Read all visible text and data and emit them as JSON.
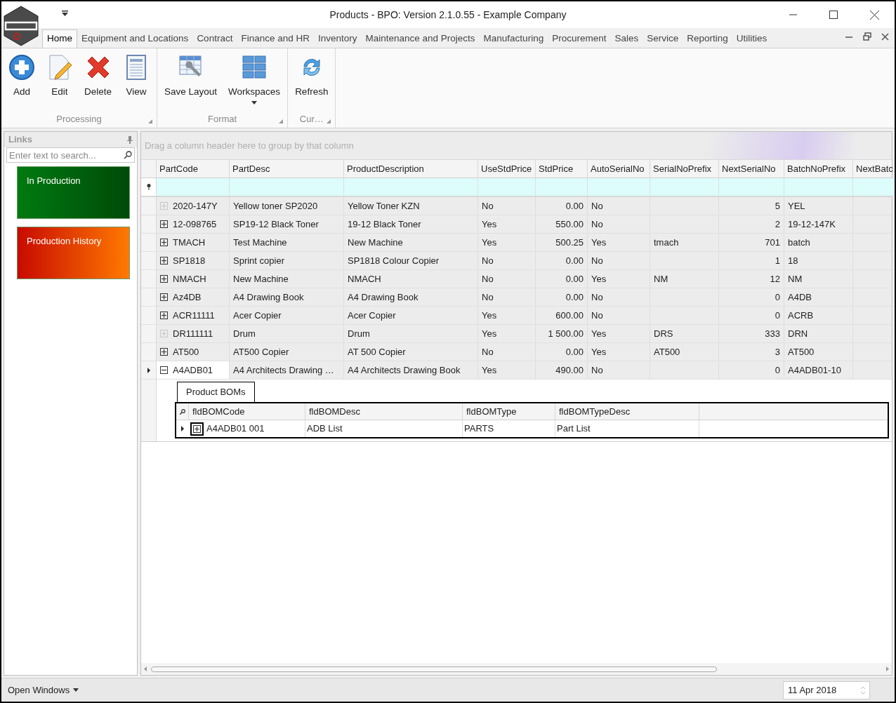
{
  "window": {
    "title": "Products - BPO: Version 2.1.0.55 - Example Company"
  },
  "tabs": [
    {
      "label": "Home",
      "selected": true
    },
    {
      "label": "Equipment and Locations",
      "selected": false
    },
    {
      "label": "Contract",
      "selected": false
    },
    {
      "label": "Finance and HR",
      "selected": false
    },
    {
      "label": "Inventory",
      "selected": false
    },
    {
      "label": "Maintenance and Projects",
      "selected": false
    },
    {
      "label": "Manufacturing",
      "selected": false
    },
    {
      "label": "Procurement",
      "selected": false
    },
    {
      "label": "Sales",
      "selected": false
    },
    {
      "label": "Service",
      "selected": false
    },
    {
      "label": "Reporting",
      "selected": false
    },
    {
      "label": "Utilities",
      "selected": false
    }
  ],
  "ribbon_groups": [
    {
      "label": "Processing",
      "buttons": [
        {
          "label": "Add",
          "kind": "add",
          "dropdown": false
        },
        {
          "label": "Edit",
          "kind": "edit",
          "dropdown": false
        },
        {
          "label": "Delete",
          "kind": "delete",
          "dropdown": false
        },
        {
          "label": "View",
          "kind": "view",
          "dropdown": false
        }
      ]
    },
    {
      "label": "Format",
      "buttons": [
        {
          "label": "Save Layout",
          "kind": "layout",
          "dropdown": false
        },
        {
          "label": "Workspaces",
          "kind": "workspaces",
          "dropdown": true
        }
      ]
    },
    {
      "label": "Cur…",
      "buttons": [
        {
          "label": "Refresh",
          "kind": "refresh",
          "dropdown": false
        }
      ]
    }
  ],
  "links_panel": {
    "title": "Links",
    "search": {
      "placeholder": "Enter text to search..."
    },
    "tiles": [
      {
        "label": "In Production",
        "color": "#007a10"
      },
      {
        "label": "Production History",
        "color": "#c80a00"
      }
    ]
  },
  "grid": {
    "group_hint": "Drag a column header here to group by that column",
    "columns": [
      "PartCode",
      "PartDesc",
      "ProductDescription",
      "UseStdPrice",
      "StdPrice",
      "AutoSerialNo",
      "SerialNoPrefix",
      "NextSerialNo",
      "BatchNoPrefix",
      "NextBatc"
    ],
    "rows": [
      {
        "cells": [
          "2020-147Y",
          "Yellow toner SP2020",
          "Yellow Toner KZN",
          "No",
          "0.00",
          "No",
          "",
          "5",
          "YEL",
          ""
        ],
        "has_children": false,
        "expanded": false,
        "selected": false
      },
      {
        "cells": [
          "12-098765",
          "SP19-12 Black Toner",
          "19-12 Black Toner",
          "Yes",
          "550.00",
          "No",
          "",
          "2",
          "19-12-147K",
          ""
        ],
        "has_children": true,
        "expanded": false,
        "selected": false
      },
      {
        "cells": [
          "TMACH",
          "Test Machine",
          "New Machine",
          "Yes",
          "500.25",
          "Yes",
          "tmach",
          "701",
          "batch",
          ""
        ],
        "has_children": true,
        "expanded": false,
        "selected": false
      },
      {
        "cells": [
          "SP1818",
          "Sprint copier",
          "SP1818 Colour Copier",
          "No",
          "0.00",
          "No",
          "",
          "1",
          "18",
          ""
        ],
        "has_children": true,
        "expanded": false,
        "selected": false
      },
      {
        "cells": [
          "NMACH",
          "New Machine",
          "NMACH",
          "No",
          "0.00",
          "Yes",
          "NM",
          "12",
          "NM",
          ""
        ],
        "has_children": true,
        "expanded": false,
        "selected": false
      },
      {
        "cells": [
          "Az4DB",
          "A4 Drawing Book",
          "A4 Drawing Book",
          "No",
          "0.00",
          "No",
          "",
          "0",
          "A4DB",
          ""
        ],
        "has_children": true,
        "expanded": false,
        "selected": false
      },
      {
        "cells": [
          "ACR11111",
          "Acer Copier",
          "Acer Copier",
          "Yes",
          "600.00",
          "No",
          "",
          "0",
          "ACRB",
          ""
        ],
        "has_children": true,
        "expanded": false,
        "selected": false
      },
      {
        "cells": [
          "DR111111",
          "Drum",
          "Drum",
          "Yes",
          "1 500.00",
          "Yes",
          "DRS",
          "333",
          "DRN",
          ""
        ],
        "has_children": false,
        "expanded": false,
        "selected": false
      },
      {
        "cells": [
          "AT500",
          "AT500 Copier",
          "AT 500 Copier",
          "No",
          "0.00",
          "Yes",
          "AT500",
          "3",
          "AT500",
          ""
        ],
        "has_children": true,
        "expanded": false,
        "selected": false
      },
      {
        "cells": [
          "A4ADB01",
          "A4 Architects Drawing …",
          "A4 Architects Drawing Book",
          "Yes",
          "490.00",
          "No",
          "",
          "0",
          "A4ADB01-10",
          ""
        ],
        "has_children": true,
        "expanded": true,
        "selected": true
      }
    ],
    "detail": {
      "tab": "Product BOMs",
      "columns": [
        "fldBOMCode",
        "fldBOMDesc",
        "fldBOMType",
        "fldBOMTypeDesc"
      ],
      "rows": [
        {
          "cells": [
            "A4ADB01 001",
            "ADB List",
            "PARTS",
            "Part List"
          ],
          "expanded": false
        }
      ]
    }
  },
  "status_bar": {
    "open_windows": "Open Windows",
    "date": "11 Apr 2018"
  }
}
